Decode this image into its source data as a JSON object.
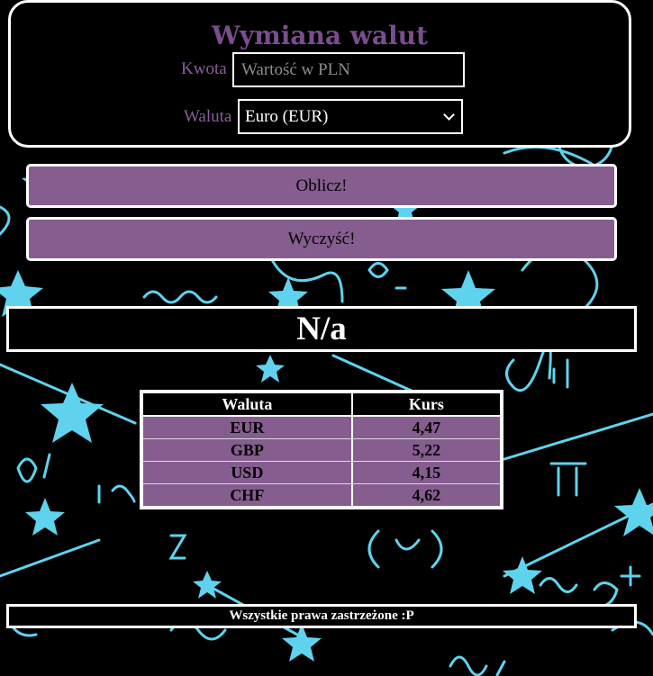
{
  "form": {
    "title": "Wymiana walut",
    "amount_label": "Kwota",
    "amount_placeholder": "Wartość w PLN",
    "amount_value": "",
    "currency_label": "Waluta",
    "currency_selected": "Euro (EUR)"
  },
  "buttons": {
    "calculate": "Oblicz!",
    "clear": "Wyczyść!"
  },
  "result": {
    "value": "N/a"
  },
  "rates": {
    "headers": [
      "Waluta",
      "Kurs"
    ],
    "rows": [
      {
        "currency": "EUR",
        "rate": "4,47"
      },
      {
        "currency": "GBP",
        "rate": "5,22"
      },
      {
        "currency": "USD",
        "rate": "4,15"
      },
      {
        "currency": "CHF",
        "rate": "4,62"
      }
    ]
  },
  "footer": {
    "text": "Wszystkie prawa zastrzeżone :P"
  },
  "colors": {
    "accent_purple": "#865d8f",
    "title_purple": "#7a4e8e",
    "doodle_cyan": "#5fd3ee",
    "background": "#000000",
    "border": "#ffffff"
  },
  "icons": {
    "select_arrow": "chevron-down-icon"
  }
}
